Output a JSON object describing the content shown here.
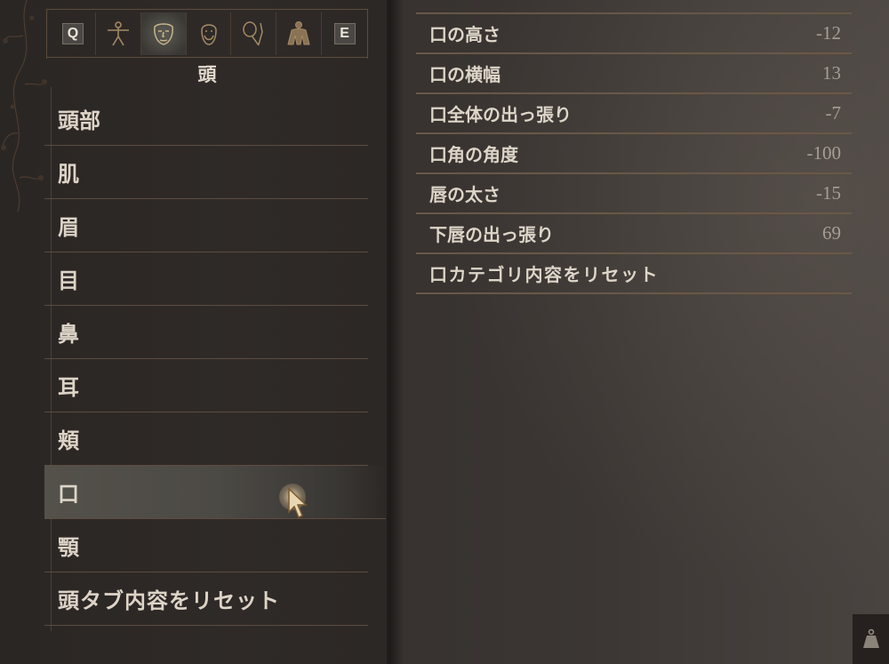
{
  "tabs": [
    {
      "type": "key",
      "label": "Q",
      "name": "tab-key-q"
    },
    {
      "type": "icon",
      "icon": "body-figure-icon",
      "name": "tab-body"
    },
    {
      "type": "icon",
      "icon": "face-mask-icon",
      "name": "tab-head",
      "active": true
    },
    {
      "type": "icon",
      "icon": "bearded-head-icon",
      "name": "tab-hair"
    },
    {
      "type": "icon",
      "icon": "hand-mirror-icon",
      "name": "tab-makeup"
    },
    {
      "type": "icon",
      "icon": "torso-icon",
      "name": "tab-physique"
    },
    {
      "type": "key",
      "label": "E",
      "name": "tab-key-e"
    }
  ],
  "tab_title": "頭",
  "categories": [
    {
      "label": "頭部"
    },
    {
      "label": "肌"
    },
    {
      "label": "眉"
    },
    {
      "label": "目"
    },
    {
      "label": "鼻"
    },
    {
      "label": "耳"
    },
    {
      "label": "頬"
    },
    {
      "label": "口",
      "selected": true
    },
    {
      "label": "顎"
    },
    {
      "label": "頭タブ内容をリセット",
      "reset": true
    }
  ],
  "params": [
    {
      "label": "口の高さ",
      "value": "-12"
    },
    {
      "label": "口の横幅",
      "value": "13"
    },
    {
      "label": "口全体の出っ張り",
      "value": "-7"
    },
    {
      "label": "口角の角度",
      "value": "-100"
    },
    {
      "label": "唇の太さ",
      "value": "-15"
    },
    {
      "label": "下唇の出っ張り",
      "value": "69"
    },
    {
      "label": "口カテゴリ内容をリセット",
      "value": ""
    }
  ],
  "colors": {
    "accent_line": "#6a5847",
    "text": "#ddd5c8",
    "value_text": "#a69e94",
    "selected_bg": "#54514b"
  },
  "corner_icon": "weight-icon"
}
